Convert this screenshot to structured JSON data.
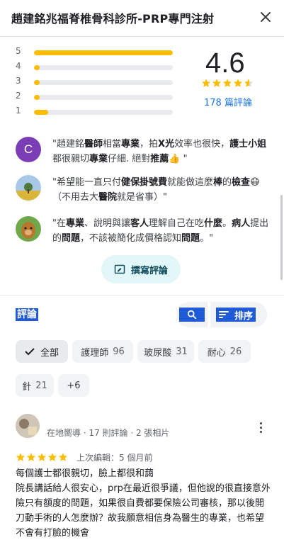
{
  "header": {
    "title": "趙建銘兆福脊椎骨科診所-PRP專門注射",
    "close_icon": "close-icon"
  },
  "rating": {
    "distribution": [
      {
        "star": "5",
        "fraction": 1.0
      },
      {
        "star": "4",
        "fraction": 0.02
      },
      {
        "star": "3",
        "fraction": 0.01
      },
      {
        "star": "2",
        "fraction": 0.01
      },
      {
        "star": "1",
        "fraction": 0.1
      }
    ],
    "average": "4.6",
    "average_value": 4.6,
    "count_label": "178 篇評論",
    "star_color": "#fbbc04"
  },
  "snippets": [
    {
      "avatar_letter": "C",
      "avatar_color": "#7b3db6"
    },
    {
      "avatar_letter": ""
    },
    {
      "avatar_letter": ""
    }
  ],
  "write_review": {
    "label": "撰寫評論",
    "icon": "write-review-icon"
  },
  "reviews_section": {
    "label": "評論",
    "search_icon": "search-icon",
    "sort_label": "排序",
    "sort_icon": "sort-icon"
  },
  "chips": [
    {
      "label": "全部",
      "count": ""
    },
    {
      "label": "護理師",
      "count": "96"
    },
    {
      "label": "玻尿酸",
      "count": "31"
    },
    {
      "label": "耐心",
      "count": "26"
    },
    {
      "label": "針",
      "count": "21"
    },
    {
      "label": "+6",
      "count": ""
    }
  ],
  "review": {
    "name": "",
    "meta": "在地嚮導 · 17 則評論 · 2 張相片",
    "rating": 5,
    "edited": "上次編輯：5 個月前",
    "body": "每個護士都很親切，臉上都很和藹\n院長講話給人很安心，prp在最近很爭議，但他說的很直接意外險只有額度的問題，如果很自費都要保險公司審核，那以後開刀動手術的人怎麼辦？故我願意相信身為醫生的專業，也希望不會有打臉的機會"
  },
  "accent": "#1a73e8",
  "highlight": "#1f5bd6"
}
